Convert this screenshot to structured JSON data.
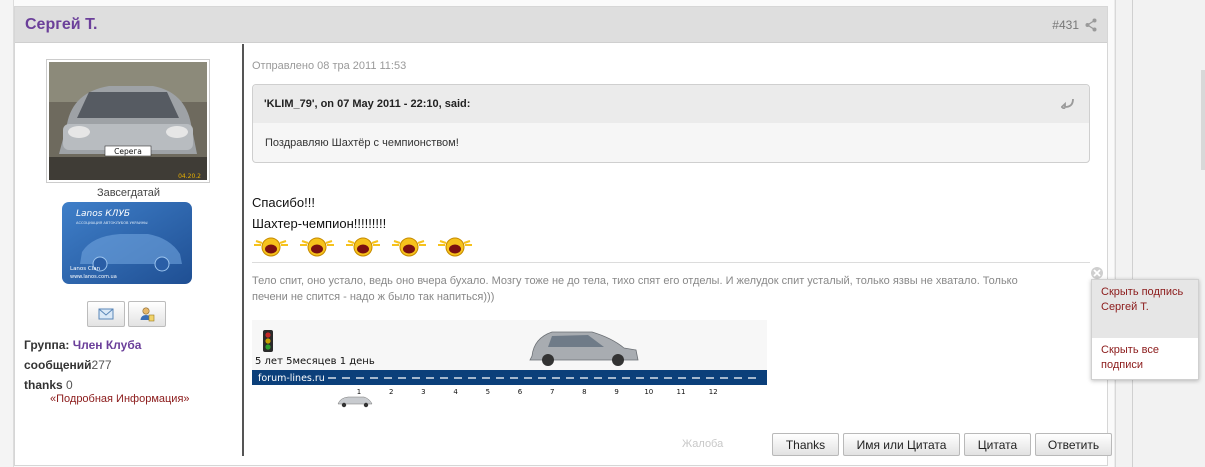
{
  "post": {
    "author": "Сергей Т.",
    "number": "#431",
    "posted": "Отправлено 08 тра 2011 11:53"
  },
  "user": {
    "avatar_plate": "Серега",
    "avatar_date": "04.20.2",
    "rank": "Завсегдатай",
    "club_card": {
      "brand": "Lanos КЛУБ",
      "subtitle": "АССОЦИАЦИЯ АВТОКЛУБОВ УКРАИНЫ",
      "name": "Lanos Clan",
      "url": "www.lanos.com.ua"
    },
    "group_label": "Группа:",
    "group_value": "Член Клуба",
    "posts_label": "сообщений",
    "posts_value": "277",
    "thanks_label": "thanks",
    "thanks_value": "0",
    "more_info": "«Подробная Информация»"
  },
  "quote": {
    "cite": "'KLIM_79', on 07 May 2011 - 22:10, said:",
    "body": "Поздравляю Шахтёр с чемпионством!"
  },
  "message": {
    "line1": "Спасибо!!!",
    "line2": "Шахтер-чемпион!!!!!!!!!"
  },
  "signature": {
    "text": "Тело спит, оно устало, ведь оно вчера бухало. Мозгу тоже не до тела, тихо спят его отделы. И желудок спит усталый, только язвы не хватало. Только печени не спится - надо ж было так напиться)))",
    "banner": {
      "duration": "5 лет 5месяцев 1 день",
      "site": "forum-lines.ru",
      "months": [
        "1",
        "2",
        "3",
        "4",
        "5",
        "6",
        "7",
        "8",
        "9",
        "10",
        "11",
        "12"
      ]
    }
  },
  "popup": {
    "hide_signature": "Скрыть подпись Сергей Т.",
    "hide_all": "Скрыть все подписи"
  },
  "actions": {
    "report": "Жалоба",
    "thanks": "Thanks",
    "name_or_quote": "Имя или Цитата",
    "quote": "Цитата",
    "reply": "Ответить"
  },
  "colors": {
    "author": "#6b3f9a",
    "link": "#8b1a1a",
    "banner_bar": "#0b3f7a"
  }
}
